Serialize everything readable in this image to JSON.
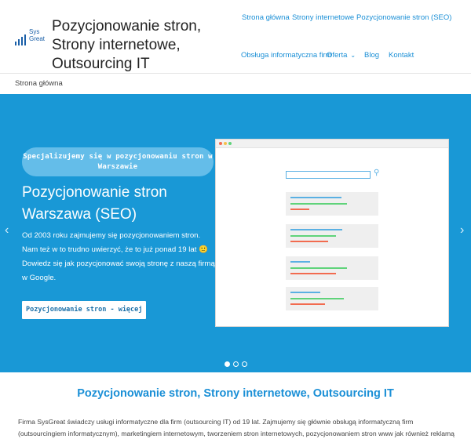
{
  "header": {
    "logo_text_1": "Sys",
    "logo_text_2": "Great",
    "site_title": "Pozycjonowanie stron, Strony internetowe, Outsourcing IT"
  },
  "nav": {
    "home": "Strona główna",
    "websites": "Strony internetowe",
    "seo": "Pozycjonowanie stron (SEO)",
    "it_service": "Obsługa informatyczna firm",
    "offer": "Oferta",
    "blog": "Blog",
    "contact": "Kontakt"
  },
  "breadcrumb": "Strona główna",
  "hero": {
    "pill": "Specjalizujemy się w pozycjonowaniu stron w Warszawie",
    "title": "Pozycjonowanie stron Warszawa (SEO)",
    "text": "Od 2003 roku zajmujemy się pozycjonowaniem stron. Nam też w to trudno uwierzyć, że to już ponad 19 lat 🙂 Dowiedz się jak pozycjonować swoją stronę z naszą firmą w Google.",
    "button": "Pozycjonowanie stron - więcej",
    "prev_arrow": "‹",
    "next_arrow": "›",
    "active_slide": 1,
    "slide_count": 3
  },
  "content": {
    "section_title": "Pozycjonowanie stron, Strony internetowe, Outsourcing IT",
    "intro": "Firma SysGreat świadczy usługi informatyczne dla firm (outsourcing IT) od 19 lat. Zajmujemy się głównie obsługą informatyczną firm (outsourcingiem informatycznym), marketingiem internetowym, tworzeniem stron internetowych, pozycjonowaniem stron www jak również reklamą w internecie. Działamy na"
  },
  "colors": {
    "hero_bg": "#1998d6",
    "link": "#1a8fd6",
    "mock_blue": "#5ab0e3",
    "mock_green": "#5fd37a",
    "mock_red": "#f26b4f"
  }
}
